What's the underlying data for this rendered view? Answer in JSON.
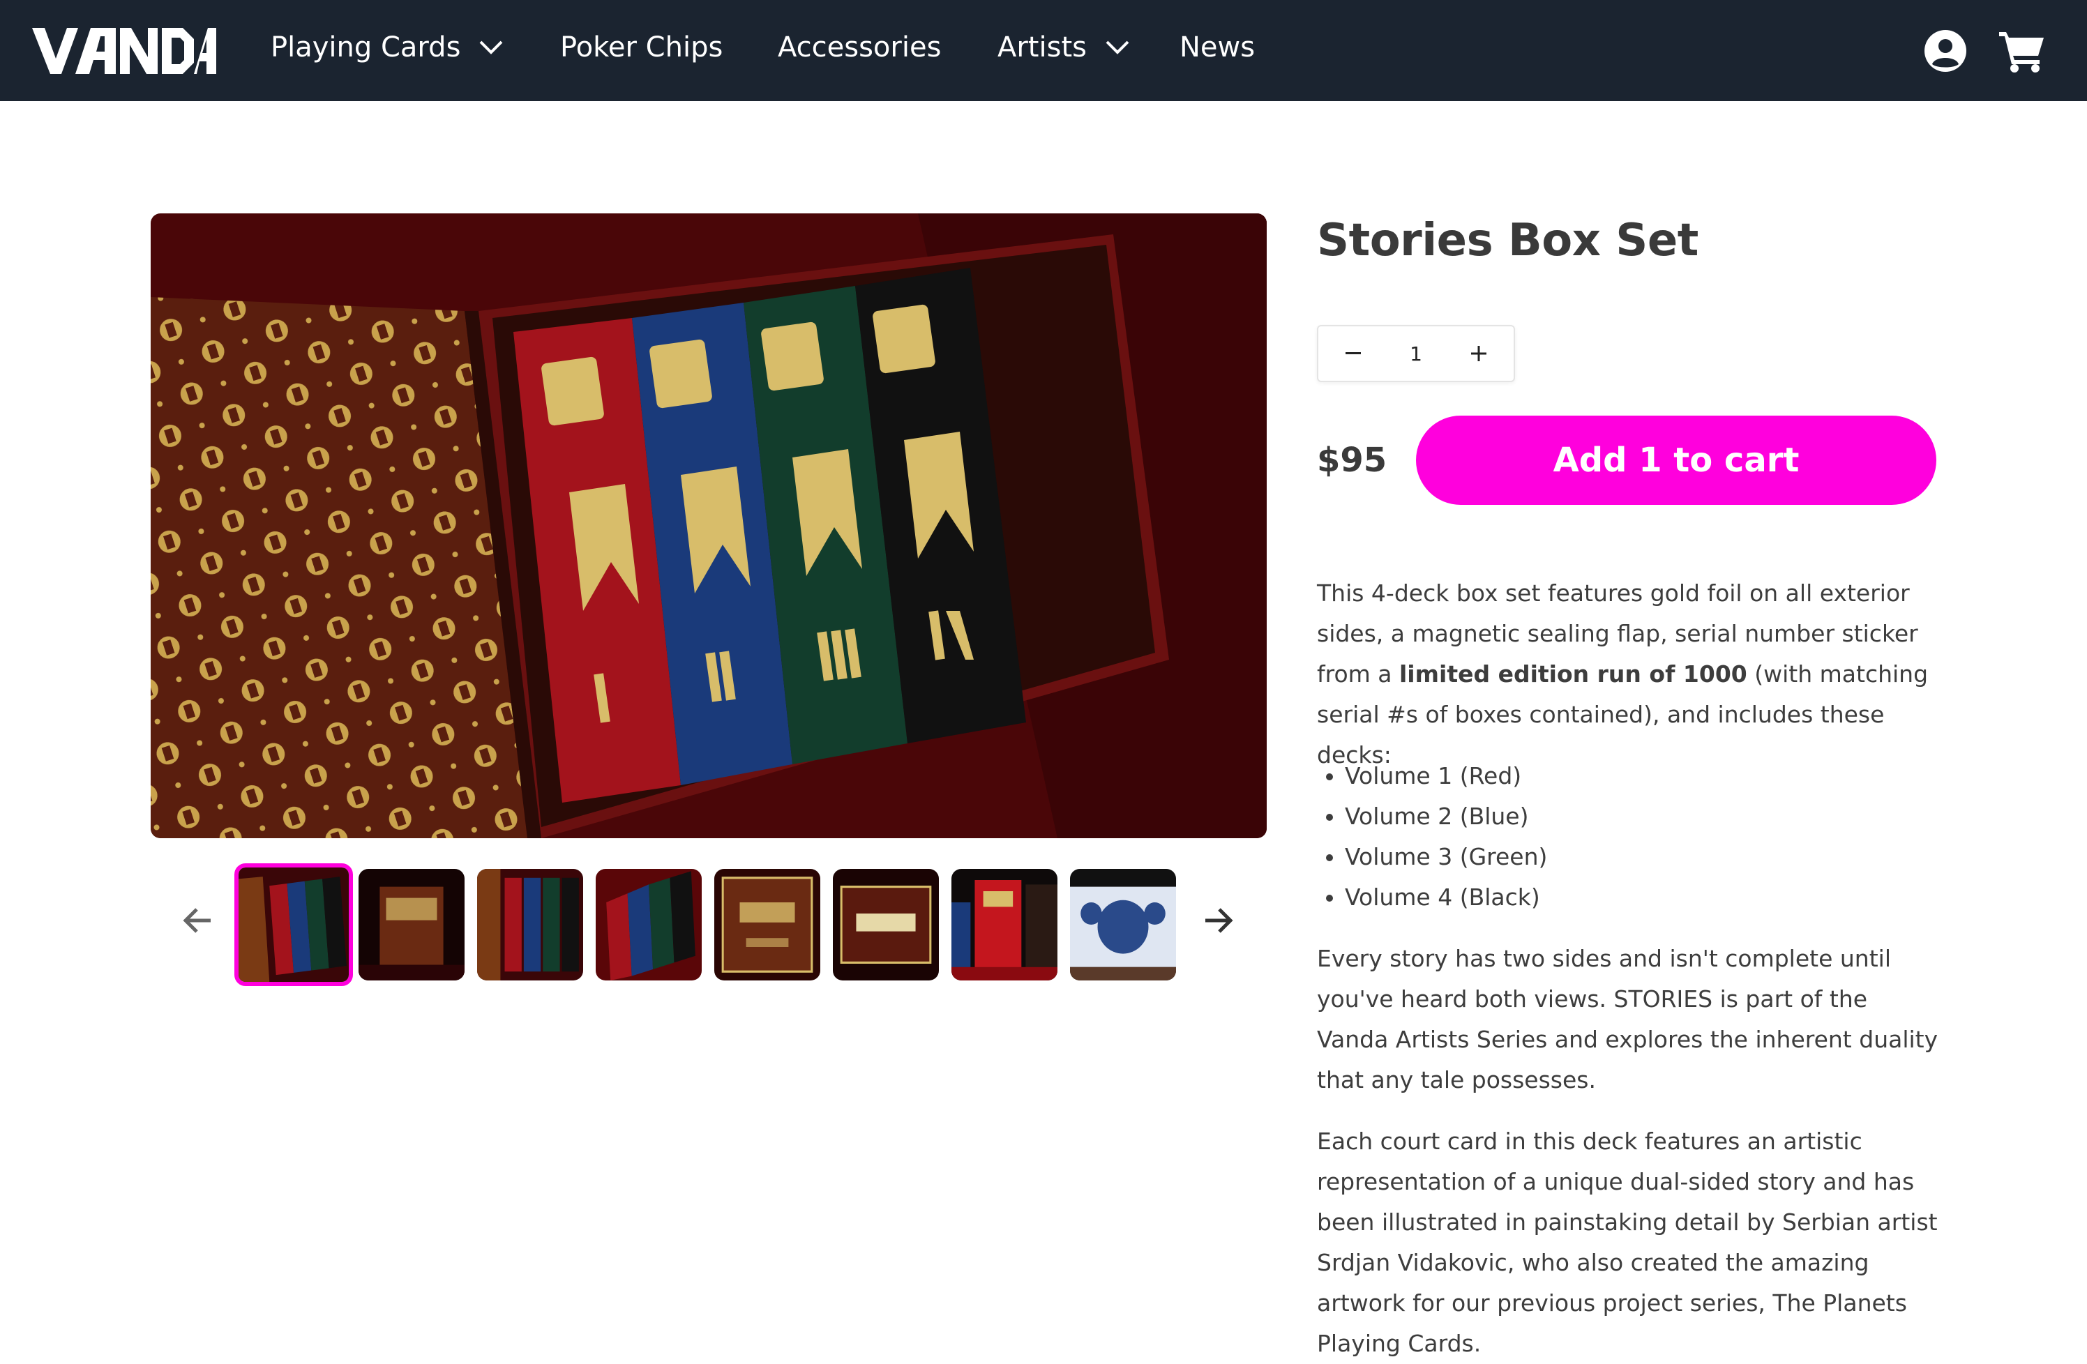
{
  "header": {
    "logo_text": "VANDA",
    "nav": [
      {
        "label": "Playing Cards",
        "has_dropdown": true
      },
      {
        "label": "Poker Chips",
        "has_dropdown": false
      },
      {
        "label": "Accessories",
        "has_dropdown": false
      },
      {
        "label": "Artists",
        "has_dropdown": true
      },
      {
        "label": "News",
        "has_dropdown": false
      }
    ],
    "icons": [
      "account-icon",
      "cart-icon"
    ]
  },
  "gallery": {
    "thumbnail_count": 8,
    "active_thumbnail": 1
  },
  "product": {
    "title": "Stories Box Set",
    "quantity": "1",
    "price": "$95",
    "add_to_cart_label": "Add 1 to cart",
    "desc_p1_before": "This 4-deck box set features gold foil on all exterior sides, a magnetic sealing flap, serial number sticker from a ",
    "desc_p1_bold": "limited edition run of 1000",
    "desc_p1_after": " (with matching serial #s of boxes contained), and includes these decks:",
    "decks": [
      "Volume 1 (Red)",
      "Volume 2 (Blue)",
      "Volume 3 (Green)",
      "Volume 4 (Black)"
    ],
    "desc_p2": "Every story has two sides and isn't complete until you've heard both views. STORIES is part of the Vanda Artists Series and explores the inherent duality that any tale possesses.",
    "desc_p3": "Each court card in this deck features an artistic representation of a unique dual-sided story and has been illustrated in painstaking detail by Serbian artist Srdjan Vidakovic, who also created the amazing artwork for our previous project series, The Planets Playing Cards."
  },
  "colors": {
    "header_bg": "#1b2430",
    "accent": "#ff00dd",
    "deck_red": "#a3131c",
    "deck_blue": "#1a3a7a",
    "deck_green": "#123d2c",
    "deck_black": "#111111",
    "gold": "#d8bd6a"
  }
}
